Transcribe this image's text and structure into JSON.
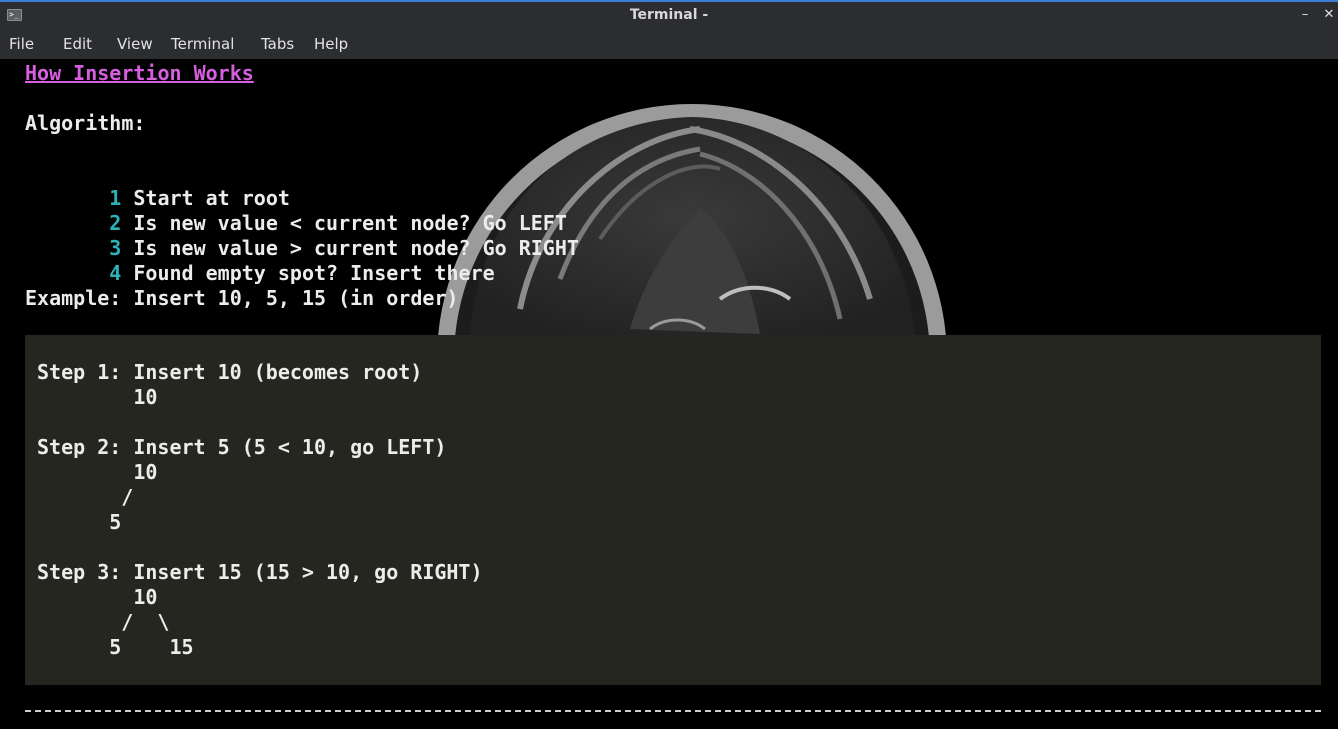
{
  "window": {
    "title": "Terminal -",
    "buttons": {
      "minimize": "–",
      "maximize": "□",
      "close": "✕"
    }
  },
  "menu": [
    "File",
    "Edit",
    "View",
    "Terminal",
    "Tabs",
    "Help"
  ],
  "content": {
    "heading": "How Insertion Works",
    "algorithm_label": "Algorithm:",
    "steps": [
      {
        "num": "1",
        "text": "Start at root"
      },
      {
        "num": "2",
        "text": "Is new value < current node? Go LEFT"
      },
      {
        "num": "3",
        "text": "Is new value > current node? Go RIGHT"
      },
      {
        "num": "4",
        "text": "Found empty spot? Insert there"
      }
    ],
    "example": "Example: Insert 10, 5, 15 (in order)",
    "code_lines": [
      "",
      "Step 1: Insert 10 (becomes root)",
      "        10",
      "",
      "Step 2: Insert 5 (5 < 10, go LEFT)",
      "        10",
      "       /",
      "      5",
      "",
      "Step 3: Insert 15 (15 > 10, go RIGHT)",
      "        10",
      "       /  \\",
      "      5    15"
    ]
  },
  "colors": {
    "heading": "#d55fde",
    "number": "#2bb3b8",
    "codebox_bg": "#262621",
    "titlebar_bg": "#2b2d30",
    "accent": "#3d7ed6"
  },
  "icons": {
    "app": "terminal-icon"
  }
}
